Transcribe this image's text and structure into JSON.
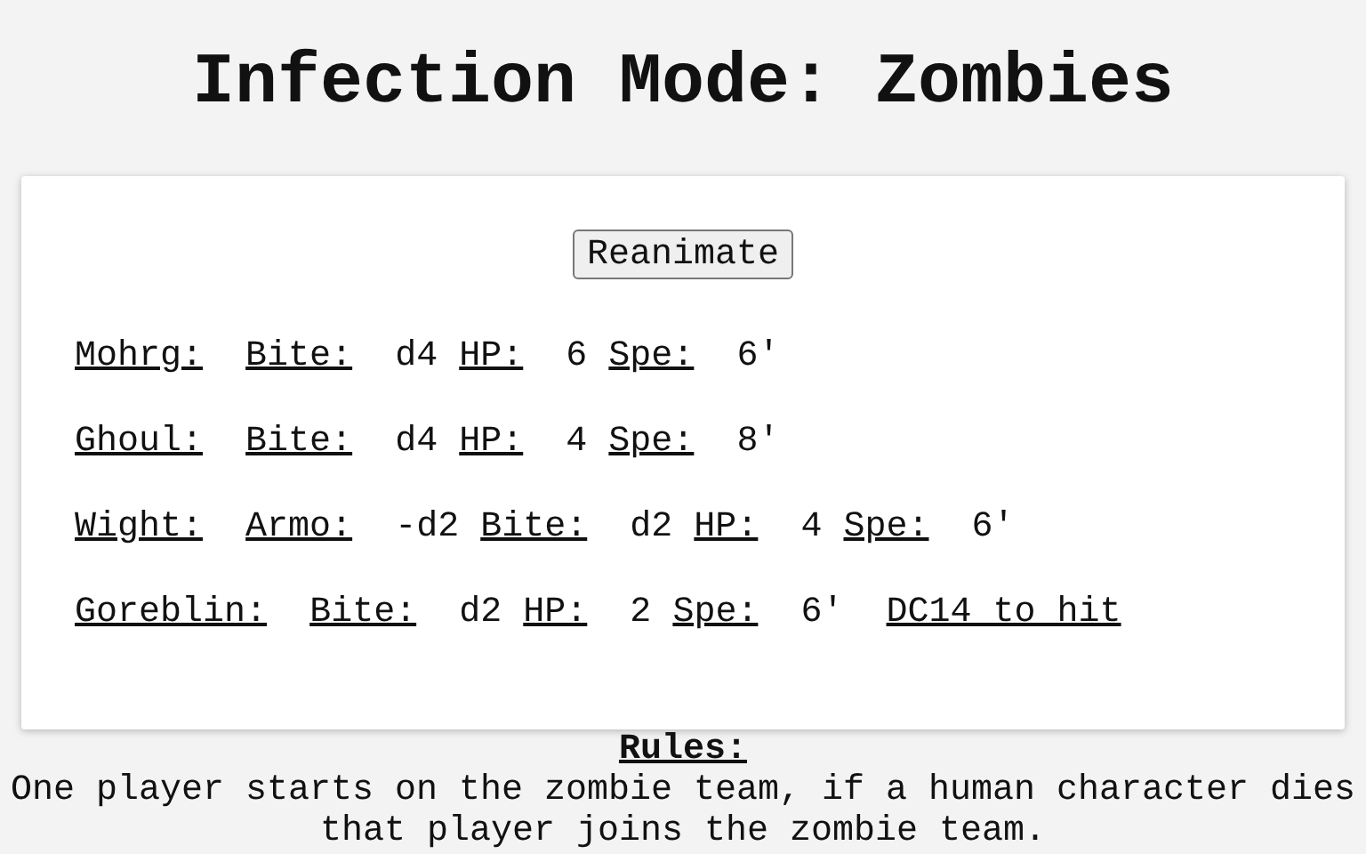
{
  "title": "Infection Mode: Zombies",
  "card": {
    "button": "Reanimate",
    "monsters": [
      {
        "name": "Mohrg:",
        "stats": [
          {
            "label": "Bite:",
            "value": "d4"
          },
          {
            "label": "HP:",
            "value": "6"
          },
          {
            "label": "Spe:",
            "value": "6'"
          }
        ]
      },
      {
        "name": "Ghoul:",
        "stats": [
          {
            "label": "Bite:",
            "value": "d4"
          },
          {
            "label": "HP:",
            "value": "4"
          },
          {
            "label": "Spe:",
            "value": "8'"
          }
        ]
      },
      {
        "name": "Wight:",
        "stats": [
          {
            "label": "Armo:",
            "value": "-d2"
          },
          {
            "label": "Bite:",
            "value": "d2"
          },
          {
            "label": "HP:",
            "value": "4"
          },
          {
            "label": "Spe:",
            "value": "6'"
          }
        ]
      },
      {
        "name": "Goreblin:",
        "stats": [
          {
            "label": "Bite:",
            "value": "d2"
          },
          {
            "label": "HP:",
            "value": "2"
          },
          {
            "label": "Spe:",
            "value": "6'"
          }
        ],
        "note": "DC14 to hit"
      }
    ]
  },
  "rules": {
    "heading": "Rules:",
    "text": "One player starts on the zombie team, if a human character dies that player joins the zombie team."
  }
}
